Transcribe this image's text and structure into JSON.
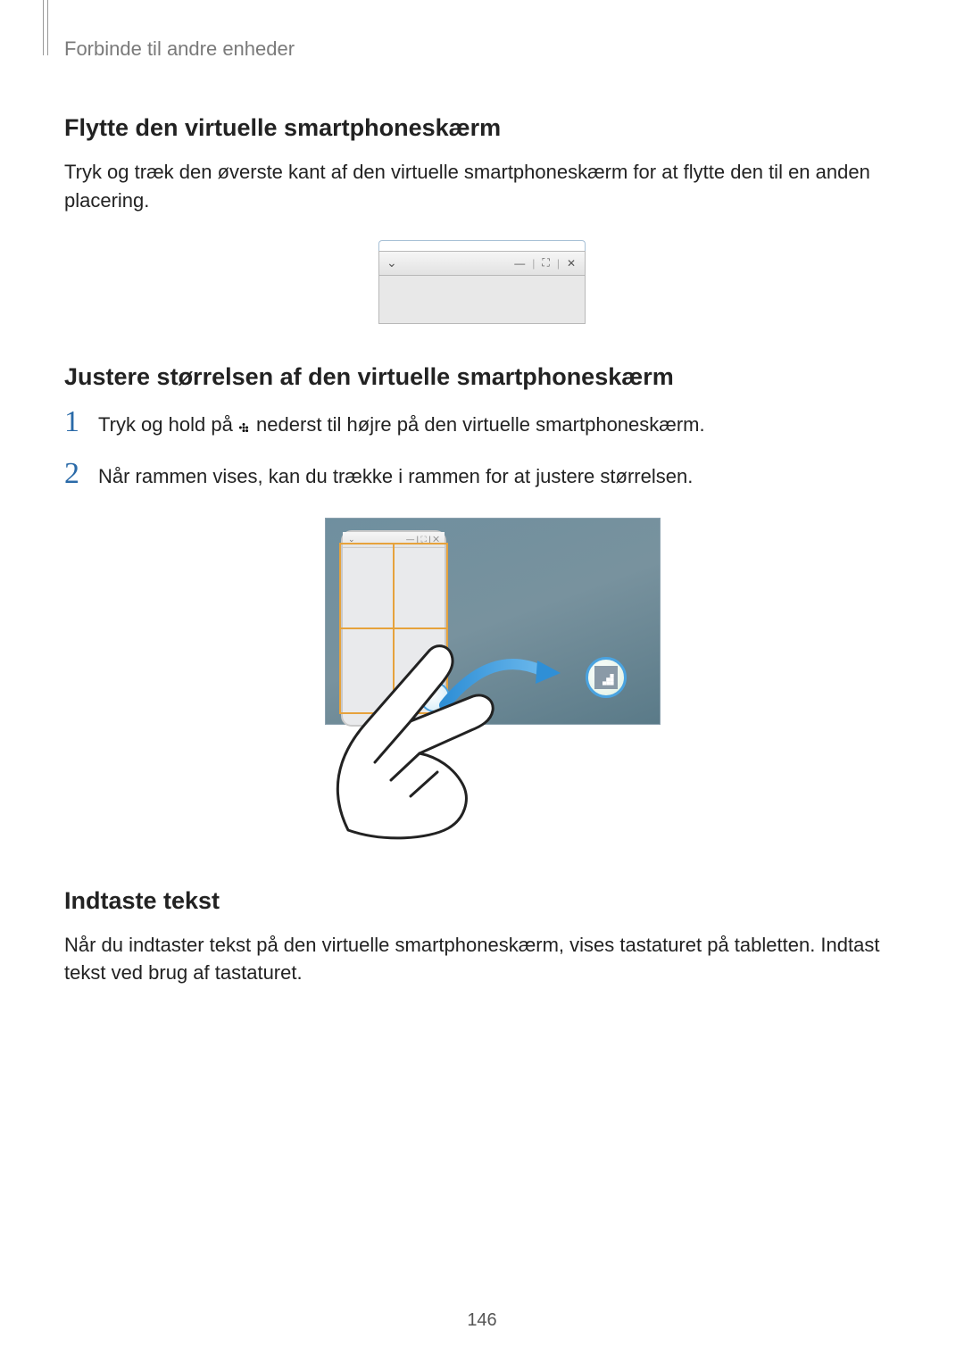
{
  "breadcrumb": "Forbinde til andre enheder",
  "section1": {
    "heading": "Flytte den virtuelle smartphoneskærm",
    "body": "Tryk og træk den øverste kant af den virtuelle smartphoneskærm for at flytte den til en anden placering."
  },
  "section2": {
    "heading": "Justere størrelsen af den virtuelle smartphoneskærm",
    "steps": [
      {
        "num": "1",
        "pre": "Tryk og hold på ",
        "post": " nederst til højre på den virtuelle smartphoneskærm."
      },
      {
        "num": "2",
        "pre": "Når rammen vises, kan du trække i rammen for at justere størrelsen.",
        "post": ""
      }
    ]
  },
  "section3": {
    "heading": "Indtaste tekst",
    "body": "Når du indtaster tekst på den virtuelle smartphoneskærm, vises tastaturet på tabletten. Indtast tekst ved brug af tastaturet."
  },
  "figure1": {
    "icons": {
      "dropdown": "⌄",
      "minimize": "—",
      "maximize": "⛶",
      "close": "✕"
    }
  },
  "page_number": "146"
}
